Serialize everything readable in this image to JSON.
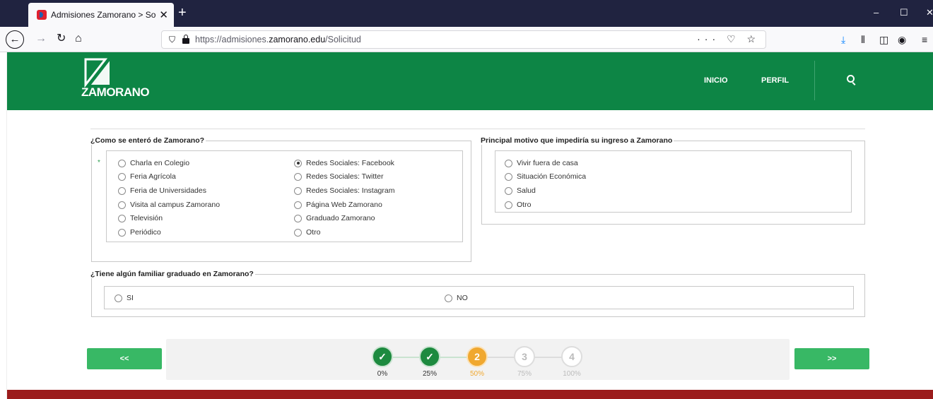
{
  "browser": {
    "tab_title": "Admisiones Zamorano > Solicit",
    "tab_close": "✕",
    "new_tab": "+",
    "url_prefix": "https://admisiones.",
    "url_domain": "zamorano.edu",
    "url_path": "/Solicitud",
    "url_actions": "··· ♡ ☆",
    "win_min": "–",
    "win_max": "☐",
    "win_close": "✕"
  },
  "site": {
    "logo_text": "ZAMORANO",
    "nav": [
      "INICIO",
      "PERFIL"
    ],
    "accent": "#0d8545",
    "button_color": "#38b865",
    "footer_color": "#9b1c1c"
  },
  "q1": {
    "legend": "¿Como se enteró de Zamorano?",
    "required_mark": "*",
    "options_col1": [
      "Charla en Colegio",
      "Feria Agrícola",
      "Feria de Universidades",
      "Visita al campus Zamorano",
      "Televisión",
      "Periódico"
    ],
    "options_col2": [
      "Redes Sociales: Facebook",
      "Redes Sociales: Twitter",
      "Redes Sociales: Instagram",
      "Página Web Zamorano",
      "Graduado Zamorano",
      "Otro"
    ],
    "selected": "Redes Sociales: Facebook"
  },
  "q2": {
    "legend": "Principal motivo que impediría su ingreso a Zamorano",
    "options": [
      "Vivir fuera de casa",
      "Situación Económica",
      "Salud",
      "Otro"
    ]
  },
  "q3": {
    "legend": "¿Tiene algún familiar graduado en Zamorano?",
    "options": [
      "SI",
      "NO"
    ]
  },
  "wizard": {
    "prev_label": "<<",
    "next_label": ">>",
    "steps": [
      {
        "mark": "✓",
        "label": "0%",
        "state": "done"
      },
      {
        "mark": "✓",
        "label": "25%",
        "state": "done"
      },
      {
        "mark": "2",
        "label": "50%",
        "state": "current"
      },
      {
        "mark": "3",
        "label": "75%",
        "state": "todo"
      },
      {
        "mark": "4",
        "label": "100%",
        "state": "todo"
      }
    ],
    "current_color": "#f0a830",
    "done_color": "#1d8a3f"
  }
}
